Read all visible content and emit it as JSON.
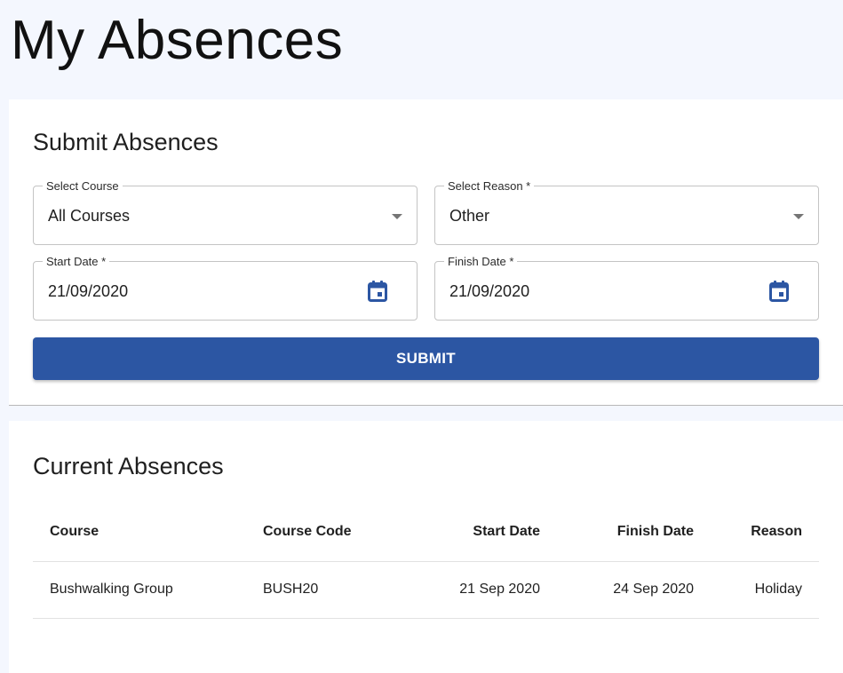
{
  "page": {
    "title": "My Absences"
  },
  "submit_card": {
    "title": "Submit Absences",
    "course": {
      "label": "Select Course",
      "value": "All Courses"
    },
    "reason": {
      "label": "Select Reason *",
      "value": "Other"
    },
    "start_date": {
      "label": "Start Date *",
      "value": "21/09/2020"
    },
    "finish_date": {
      "label": "Finish Date *",
      "value": "21/09/2020"
    },
    "submit_label": "SUBMIT",
    "accent_color": "#2c56a3"
  },
  "current_card": {
    "title": "Current Absences",
    "columns": [
      "Course",
      "Course Code",
      "Start Date",
      "Finish Date",
      "Reason"
    ],
    "rows": [
      [
        "Bushwalking Group",
        "BUSH20",
        "21 Sep 2020",
        "24 Sep 2020",
        "Holiday"
      ]
    ]
  },
  "icons": [
    "calendar-icon",
    "chevron-down-icon"
  ]
}
